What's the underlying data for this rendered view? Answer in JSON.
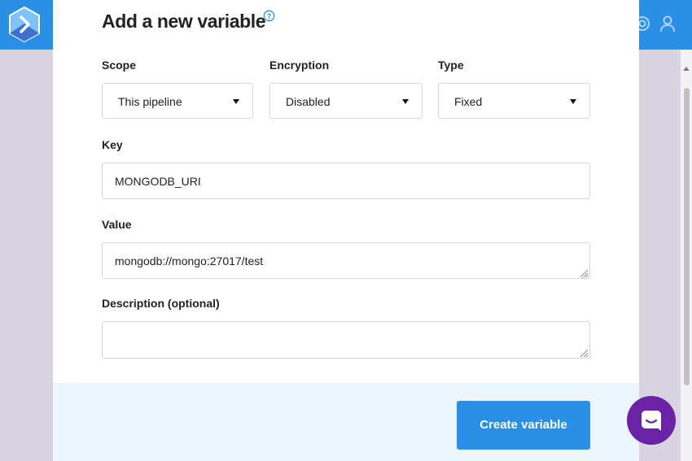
{
  "modal": {
    "title": "Add a new variable",
    "scope": {
      "label": "Scope",
      "value": "This pipeline"
    },
    "encryption": {
      "label": "Encryption",
      "value": "Disabled"
    },
    "type": {
      "label": "Type",
      "value": "Fixed"
    },
    "key": {
      "label": "Key",
      "value": "MONGODB_URI"
    },
    "value": {
      "label": "Value",
      "value": "mongodb://mongo:27017/test"
    },
    "description": {
      "label": "Description (optional)",
      "value": ""
    },
    "create_button": "Create variable"
  },
  "icons": {
    "app_logo": "app-logo-icon",
    "help": "help-icon",
    "close": "close-icon",
    "support": "support-icon",
    "user": "user-icon",
    "chat": "chat-icon"
  },
  "colors": {
    "brand_blue": "#2b8fe6",
    "footer_bg": "#edf6fd",
    "chat_purple": "#6b23a6"
  }
}
